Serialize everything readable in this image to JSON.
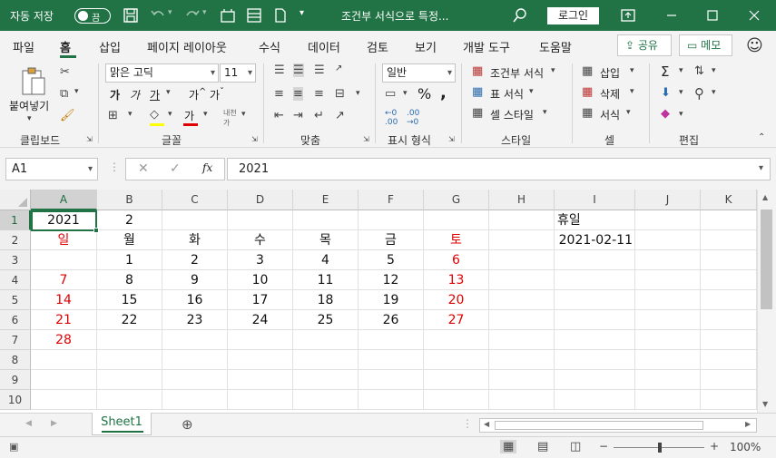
{
  "titlebar": {
    "autosave": "자동 저장",
    "toggle": "끔",
    "doc_title": "조건부 서식으로 특정...",
    "login": "로그인"
  },
  "ribbon_tabs": [
    "파일",
    "홈",
    "삽입",
    "페이지 레이아웃",
    "수식",
    "데이터",
    "검토",
    "보기",
    "개발 도구",
    "도움말"
  ],
  "share": "공유",
  "memo": "메모",
  "ribbon": {
    "clipboard": {
      "paste": "붙여넣기",
      "label": "클립보드"
    },
    "font": {
      "name": "맑은 고딕",
      "size": "11",
      "label": "글꼴"
    },
    "align": {
      "label": "맞춤"
    },
    "number": {
      "format": "일반",
      "label": "표시 형식"
    },
    "styles": {
      "cond": "조건부 서식",
      "table": "표 서식",
      "cell": "셀 스타일",
      "label": "스타일"
    },
    "cells": {
      "insert": "삽입",
      "delete": "삭제",
      "format": "서식",
      "label": "셀"
    },
    "edit": {
      "label": "편집"
    }
  },
  "formula_bar": {
    "namebox": "A1",
    "fx": "fx",
    "value": "2021"
  },
  "columns": [
    "A",
    "B",
    "C",
    "D",
    "E",
    "F",
    "G",
    "H",
    "I",
    "J",
    "K"
  ],
  "rows": [
    "1",
    "2",
    "3",
    "4",
    "5",
    "6",
    "7",
    "8",
    "9",
    "10"
  ],
  "cells": [
    [
      "2021",
      "2",
      "",
      "",
      "",
      "",
      "",
      "",
      "휴일",
      "",
      ""
    ],
    [
      "일",
      "월",
      "화",
      "수",
      "목",
      "금",
      "토",
      "",
      "2021-02-11",
      "",
      ""
    ],
    [
      "",
      "1",
      "2",
      "3",
      "4",
      "5",
      "6",
      "",
      "",
      "",
      ""
    ],
    [
      "7",
      "8",
      "9",
      "10",
      "11",
      "12",
      "13",
      "",
      "",
      "",
      ""
    ],
    [
      "14",
      "15",
      "16",
      "17",
      "18",
      "19",
      "20",
      "",
      "",
      "",
      ""
    ],
    [
      "21",
      "22",
      "23",
      "24",
      "25",
      "26",
      "27",
      "",
      "",
      "",
      ""
    ],
    [
      "28",
      "",
      "",
      "",
      "",
      "",
      "",
      "",
      "",
      "",
      ""
    ],
    [
      "",
      "",
      "",
      "",
      "",
      "",
      "",
      "",
      "",
      "",
      ""
    ],
    [
      "",
      "",
      "",
      "",
      "",
      "",
      "",
      "",
      "",
      "",
      ""
    ],
    [
      "",
      "",
      "",
      "",
      "",
      "",
      "",
      "",
      "",
      "",
      ""
    ]
  ],
  "sheet_tab": "Sheet1",
  "zoom": "100%",
  "colors": {
    "accent": "#217346",
    "weekend": "#e00000"
  }
}
